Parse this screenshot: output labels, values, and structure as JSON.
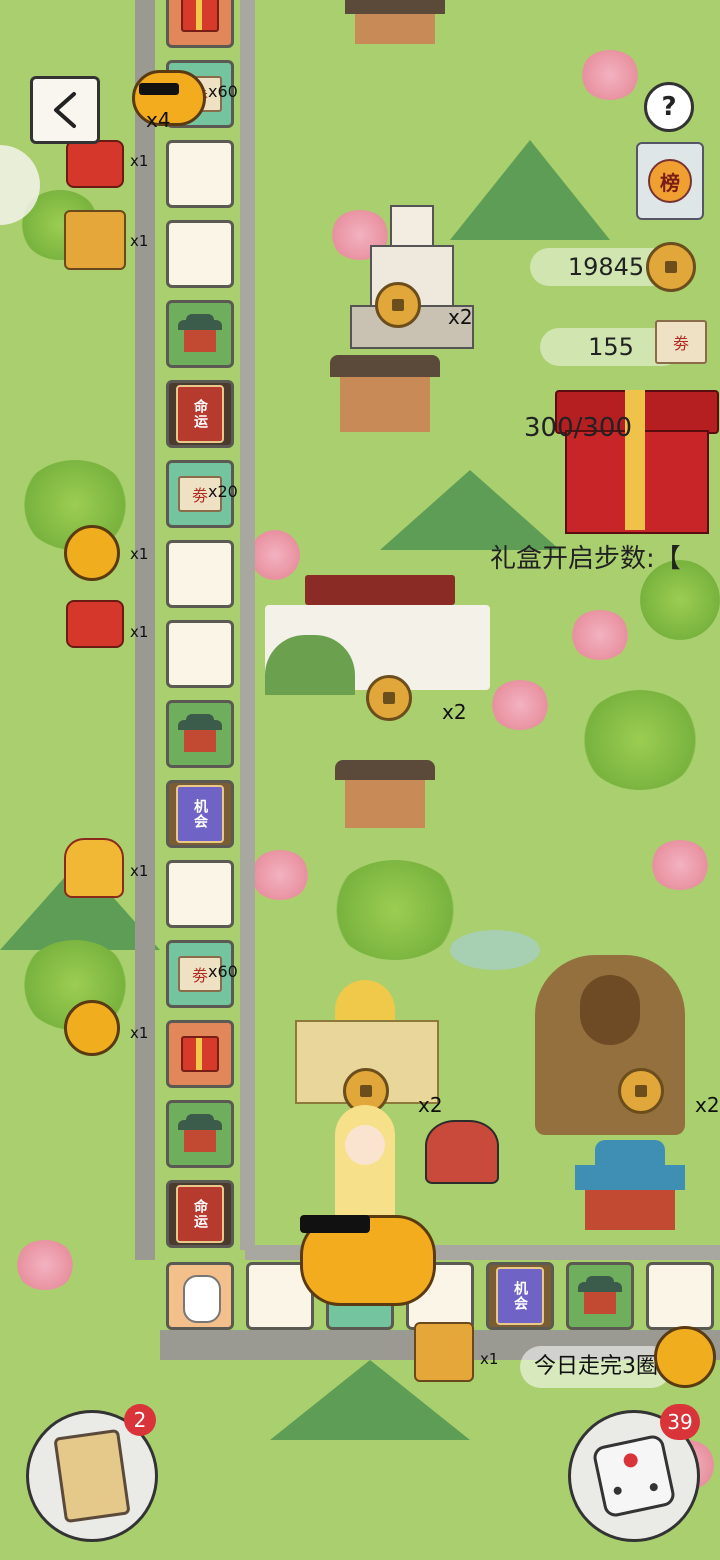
{
  "screen": {
    "back_button_label": "<",
    "help_label": "?",
    "ranking_label": "榜"
  },
  "hud": {
    "coins": "19845",
    "tickets": "155",
    "gift_progress": "300/300",
    "gift_steps_label": "礼盒开启步数:【",
    "today_label": "今日走完3圈"
  },
  "player": {
    "pig_multiplier": "x4"
  },
  "board": {
    "fate_label": "命运",
    "chance_label": "机会",
    "ticket_glyph": "劵"
  },
  "side_rewards": [
    {
      "icon": "ticket-icon",
      "count": "x60"
    },
    {
      "icon": "firecracker-icon",
      "count": "x1"
    },
    {
      "icon": "gift-bag-icon",
      "count": "x1"
    },
    {
      "icon": "ticket-icon",
      "count": "x20"
    },
    {
      "icon": "gold-pot-icon",
      "count": "x1"
    },
    {
      "icon": "firecracker-icon",
      "count": "x1"
    },
    {
      "icon": "lucky-bag-icon",
      "count": "x1"
    },
    {
      "icon": "ticket-icon",
      "count": "x60"
    },
    {
      "icon": "gold-pot-icon",
      "count": "x1"
    },
    {
      "icon": "gift-bag-icon",
      "count": "x1"
    }
  ],
  "landmark_bonus": [
    "x2",
    "x2",
    "x2",
    "x2"
  ],
  "bottom": {
    "cards_badge": "2",
    "dice_badge": "39"
  },
  "colors": {
    "background": "#a9cf6e",
    "badge": "#d9343a",
    "wall": "#9a9a92"
  }
}
